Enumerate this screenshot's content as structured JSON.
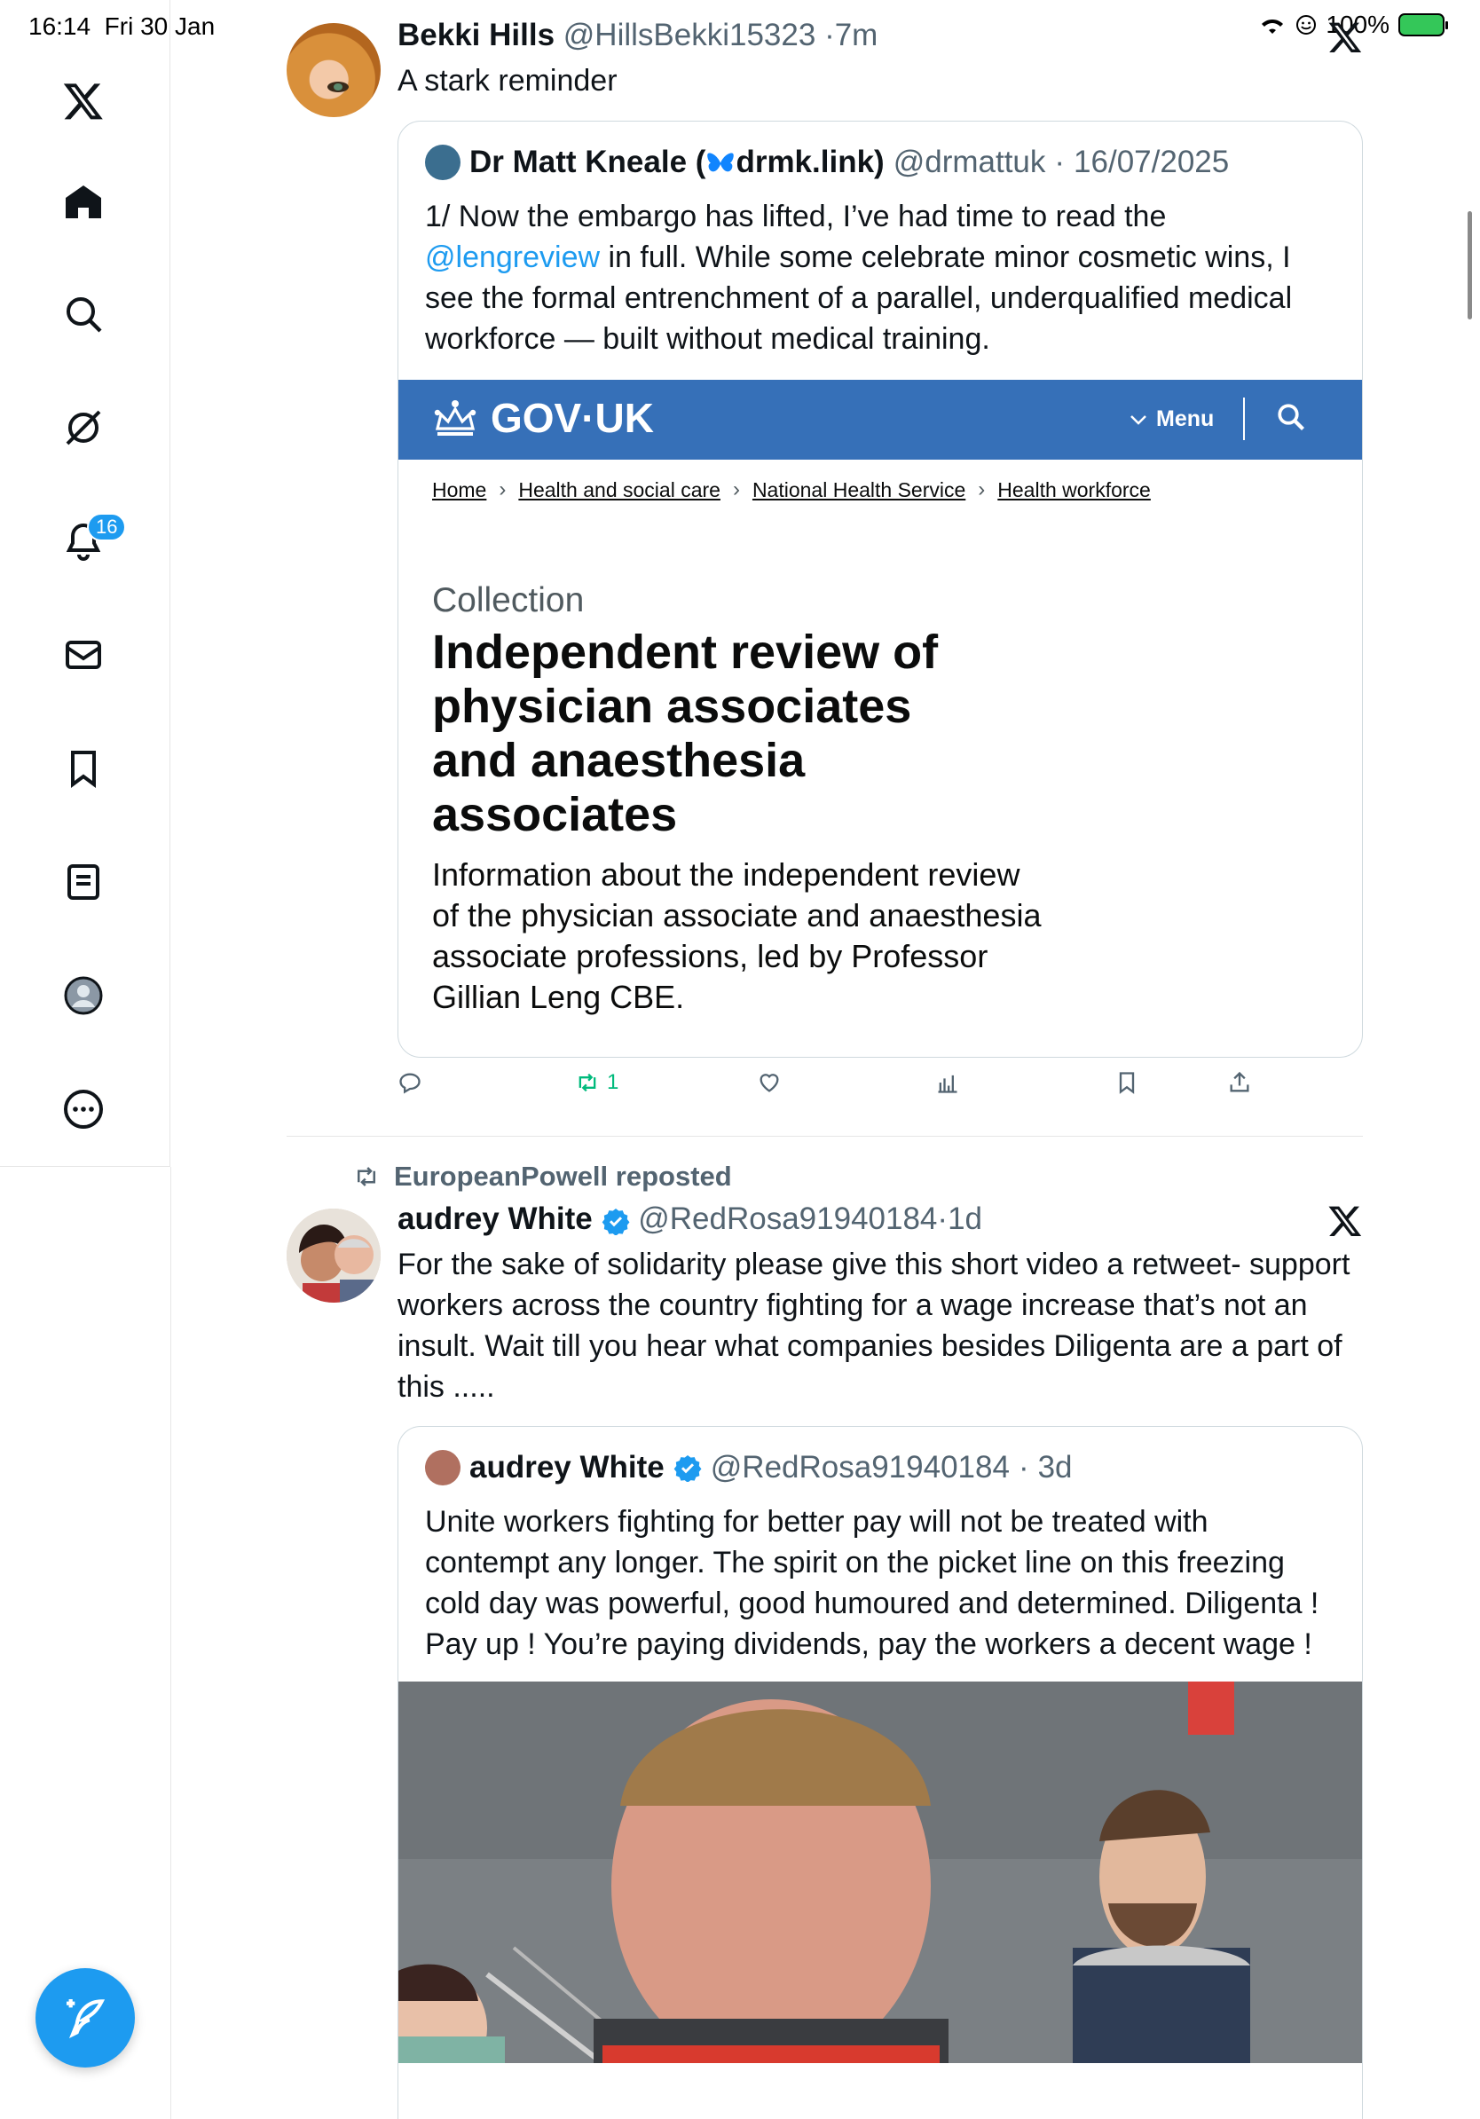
{
  "status_bar": {
    "time": "16:14",
    "date": "Fri 30 Jan",
    "battery": "100%"
  },
  "sidebar": {
    "notification_count": "16"
  },
  "tweet1": {
    "name": "Bekki Hills",
    "handle": "@HillsBekki15323",
    "time": "7m",
    "text": "A stark reminder",
    "quote": {
      "name": "Dr Matt Kneale (",
      "name_suffix": "drmk.link)",
      "handle": "@drmattuk",
      "date": "16/07/2025",
      "text_before": "1/ Now the embargo has lifted, I’ve had time to read the ",
      "mention": "@lengreview",
      "text_after": " in full. While some celebrate minor cosmetic wins, I see the formal entrenchment of a parallel, underqualified medical workforce — built without medical training.",
      "govuk": {
        "logo": "GOV·UK",
        "menu": "Menu",
        "breadcrumbs": [
          "Home",
          "Health and social care",
          "National Health Service",
          "Health workforce"
        ],
        "caption": "Collection",
        "title": "Independent review of physician associates and anaesthesia associates",
        "description": "Information about the independent review of the physician associate and anaesthesia associate professions, led by Professor Gillian Leng CBE."
      }
    },
    "retweet_count": "1"
  },
  "tweet2": {
    "repost_label": "EuropeanPowell reposted",
    "name": "audrey White",
    "handle": "@RedRosa91940184",
    "time": "1d",
    "text": "For the sake of solidarity please give this short video a retweet- support workers across the country fighting for a wage increase that’s not an insult. Wait till you hear what companies besides Diligenta are a part of this .....",
    "quote": {
      "name": "audrey White",
      "handle": "@RedRosa91940184",
      "time": "3d",
      "text": "Unite workers fighting for better pay will not be treated with contempt any longer. The spirit on the picket line on this freezing cold day was powerful, good humoured and determined. Diligenta ! Pay up ! You’re paying dividends, pay the workers a decent wage !"
    }
  },
  "colors": {
    "accent": "#1d9bf0",
    "govuk_blue": "#3670b8",
    "retweet_green": "#00ba7c"
  },
  "icons": [
    "x-logo-icon",
    "home-icon",
    "search-icon",
    "grok-icon",
    "notifications-icon",
    "messages-icon",
    "bookmarks-icon",
    "lists-icon",
    "profile-icon",
    "more-icon",
    "compose-icon"
  ]
}
